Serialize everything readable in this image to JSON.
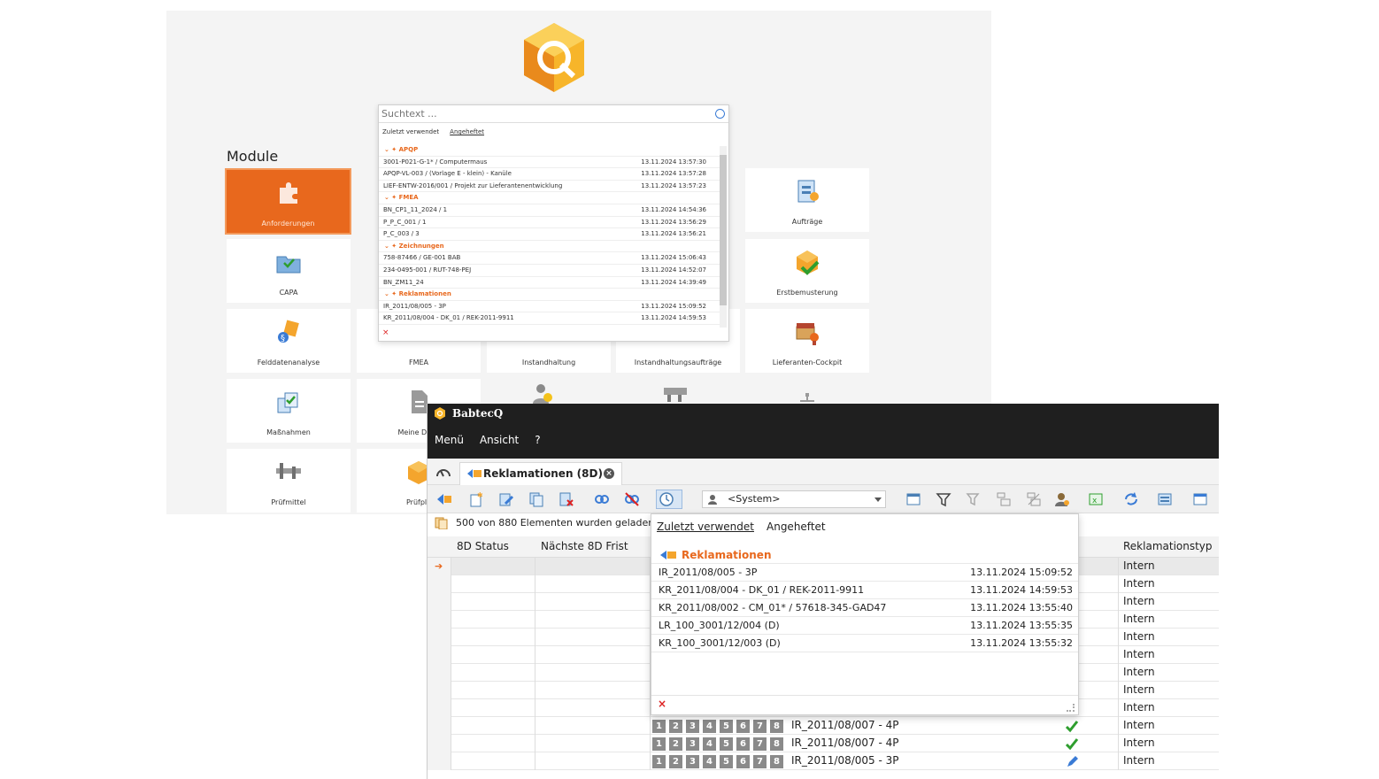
{
  "modules_panel": {
    "heading": "Module",
    "tiles": [
      {
        "label": "Anforderungen",
        "icon": "puzzle-icon"
      },
      {
        "label": "Aufträge",
        "icon": "orders-icon"
      },
      {
        "label": "CAPA",
        "icon": "folder-check-icon"
      },
      {
        "label": "Erstbemusterung",
        "icon": "green-box-icon"
      },
      {
        "label": "Felddatenanalyse",
        "icon": "field-data-icon"
      },
      {
        "label": "FMEA",
        "icon": "fmea-icon"
      },
      {
        "label": "Instandhaltung",
        "icon": "maintenance-icon"
      },
      {
        "label": "Instandhaltungsaufträge",
        "icon": "maintenance-orders-icon"
      },
      {
        "label": "Lieferanten-Cockpit",
        "icon": "supplier-icon"
      },
      {
        "label": "Maßnahmen",
        "icon": "measures-icon"
      },
      {
        "label": "Meine Doku",
        "icon": "document-icon"
      },
      {
        "label": "Prüfmittel",
        "icon": "caliper-icon"
      },
      {
        "label": "Prüfpla",
        "icon": "test-plan-icon"
      }
    ]
  },
  "search_popup": {
    "placeholder": "Suchtext ...",
    "tab_recent": "Zuletzt verwendet",
    "tab_pinned": "Angeheftet",
    "groups": [
      {
        "name": "APQP",
        "rows": [
          {
            "id": "3001-P021-G-1* / Computermaus",
            "date": "13.11.2024 13:57:30"
          },
          {
            "id": "APQP-VL-003 / (Vorlage E - klein) - Kanüle",
            "date": "13.11.2024 13:57:28"
          },
          {
            "id": "LIEF-ENTW-2016/001 / Projekt zur Lieferantenentwicklung",
            "date": "13.11.2024 13:57:23"
          }
        ]
      },
      {
        "name": "FMEA",
        "rows": [
          {
            "id": "BN_CP1_11_2024 / 1",
            "date": "13.11.2024 14:54:36"
          },
          {
            "id": "P_P_C_001 / 1",
            "date": "13.11.2024 13:56:29"
          },
          {
            "id": "P_C_003 / 3",
            "date": "13.11.2024 13:56:21"
          }
        ]
      },
      {
        "name": "Zeichnungen",
        "rows": [
          {
            "id": "758-87466 / GE-001 BAB",
            "date": "13.11.2024 15:06:43"
          },
          {
            "id": "234-0495-001 / RUT-748-PEJ",
            "date": "13.11.2024 14:52:07"
          },
          {
            "id": "BN_ZM11_24",
            "date": "13.11.2024 14:39:49"
          }
        ]
      },
      {
        "name": "Reklamationen",
        "rows": [
          {
            "id": "IR_2011/08/005 - 3P",
            "date": "13.11.2024 15:09:52"
          },
          {
            "id": "KR_2011/08/004 - DK_01 / REK-2011-9911",
            "date": "13.11.2024 14:59:53"
          }
        ]
      }
    ],
    "close": "×"
  },
  "app": {
    "title": "BabtecQ",
    "menu": [
      "Menü",
      "Ansicht",
      "?"
    ],
    "tab_label": "Reklamationen (8D)",
    "tab_close": "×",
    "system_select": "<System>",
    "status": "500 von 880 Elementen wurden geladen.",
    "grid": {
      "headers": {
        "c1": "8D Status",
        "c2": "Nächste 8D Frist",
        "type": "Reklamationstyp"
      },
      "type_values": [
        "Intern",
        "Intern",
        "Intern",
        "Intern",
        "Intern",
        "Intern",
        "Intern",
        "Intern",
        "Intern",
        "Intern",
        "Intern",
        "Intern"
      ],
      "steps": [
        "1",
        "2",
        "3",
        "4",
        "5",
        "6",
        "7",
        "8"
      ],
      "visible_rows": [
        {
          "id": "IR_2011/08/007 - 4P",
          "mark": "check"
        },
        {
          "id": "IR_2011/08/007 - 4P",
          "mark": "check"
        },
        {
          "id": "IR_2011/08/005 - 3P",
          "mark": "pencil"
        }
      ]
    },
    "popup": {
      "tab_recent": "Zuletzt verwendet",
      "tab_pinned": "Angeheftet",
      "group": "Reklamationen",
      "rows": [
        {
          "id": "IR_2011/08/005 - 3P",
          "date": "13.11.2024 15:09:52"
        },
        {
          "id": "KR_2011/08/004 - DK_01 / REK-2011-9911",
          "date": "13.11.2024 14:59:53"
        },
        {
          "id": "KR_2011/08/002 - CM_01* / 57618-345-GAD47",
          "date": "13.11.2024 13:55:40"
        },
        {
          "id": "LR_100_3001/12/004 (D)",
          "date": "13.11.2024 13:55:35"
        },
        {
          "id": "KR_100_3001/12/003 (D)",
          "date": "13.11.2024 13:55:32"
        }
      ],
      "close": "×"
    }
  },
  "colors": {
    "accent": "#e8681d",
    "titlebar": "#1f1f1f",
    "check": "#2e9e2e"
  }
}
